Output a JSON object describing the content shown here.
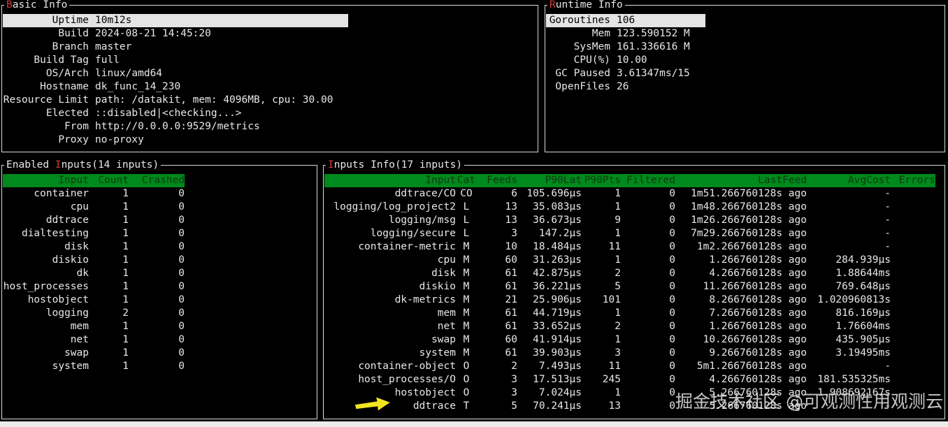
{
  "colors": {
    "background": "#000000",
    "text": "#e8e8e8",
    "border": "#d9d9d9",
    "accent_red": "#cc3b3b",
    "header_green": "#00891c",
    "header_green_text": "#0c3a10",
    "highlight_bg": "#e4e4e4",
    "highlight_text": "#000000",
    "arrow_yellow": "#f2e422"
  },
  "panels": {
    "basic_info": {
      "title": {
        "pre": "",
        "hot": "B",
        "rest": "asic Info"
      },
      "rows": [
        {
          "label": "Uptime",
          "value": "10m12s",
          "highlight": true
        },
        {
          "label": "Build",
          "value": "2024-08-21 14:45:20"
        },
        {
          "label": "Branch",
          "value": "master"
        },
        {
          "label": "Build Tag",
          "value": "full"
        },
        {
          "label": "OS/Arch",
          "value": "linux/amd64"
        },
        {
          "label": "Hostname",
          "value": "dk_func_14_230"
        },
        {
          "label": "Resource Limit",
          "value": "path: /datakit, mem: 4096MB, cpu: 30.00"
        },
        {
          "label": "Elected",
          "value": "::disabled|<checking...>"
        },
        {
          "label": "From",
          "value": "http://0.0.0.0:9529/metrics"
        },
        {
          "label": "Proxy",
          "value": "no-proxy"
        }
      ]
    },
    "runtime_info": {
      "title": {
        "pre": "",
        "hot": "R",
        "rest": "untime Info"
      },
      "rows": [
        {
          "label": "Goroutines",
          "value": "106",
          "highlight": true
        },
        {
          "label": "Mem",
          "value": "123.590152 M"
        },
        {
          "label": "SysMem",
          "value": "161.336616 M"
        },
        {
          "label": "CPU(%)",
          "value": "10.00"
        },
        {
          "label": "GC Paused",
          "value": "3.61347ms/15"
        },
        {
          "label": "OpenFiles",
          "value": "26"
        }
      ]
    },
    "enabled_inputs": {
      "title": {
        "pre": "Enabled ",
        "hot": "I",
        "rest": "nputs(14 inputs)"
      },
      "headers": [
        "Input",
        "Count",
        "Crashed"
      ],
      "rows": [
        [
          "container",
          "1",
          "0"
        ],
        [
          "cpu",
          "1",
          "0"
        ],
        [
          "ddtrace",
          "1",
          "0"
        ],
        [
          "dialtesting",
          "1",
          "0"
        ],
        [
          "disk",
          "1",
          "0"
        ],
        [
          "diskio",
          "1",
          "0"
        ],
        [
          "dk",
          "1",
          "0"
        ],
        [
          "host_processes",
          "1",
          "0"
        ],
        [
          "hostobject",
          "1",
          "0"
        ],
        [
          "logging",
          "2",
          "0"
        ],
        [
          "mem",
          "1",
          "0"
        ],
        [
          "net",
          "1",
          "0"
        ],
        [
          "swap",
          "1",
          "0"
        ],
        [
          "system",
          "1",
          "0"
        ]
      ]
    },
    "inputs_info": {
      "title": {
        "pre": "",
        "hot": "I",
        "rest": "nputs Info(17 inputs)"
      },
      "headers": [
        "Input",
        "Cat",
        "Feeds",
        "P90Lat",
        "P90Pts",
        "Filtered",
        "LastFeed",
        "AvgCost",
        "Errors"
      ],
      "rows": [
        [
          "ddtrace/CO",
          "CO",
          "6",
          "105.696µs",
          "1",
          "0",
          "1m51.266760128s ago",
          "-",
          ""
        ],
        [
          "logging/log_project2",
          "L",
          "13",
          "35.083µs",
          "1",
          "0",
          "1m48.266760128s ago",
          "-",
          ""
        ],
        [
          "logging/msg",
          "L",
          "13",
          "36.673µs",
          "9",
          "0",
          "1m26.266760128s ago",
          "-",
          ""
        ],
        [
          "logging/secure",
          "L",
          "3",
          "147.2µs",
          "1",
          "0",
          "7m29.266760128s ago",
          "-",
          ""
        ],
        [
          "container-metric",
          "M",
          "10",
          "18.484µs",
          "11",
          "0",
          "1m2.266760128s ago",
          "-",
          ""
        ],
        [
          "cpu",
          "M",
          "60",
          "31.263µs",
          "1",
          "0",
          "1.266760128s ago",
          "284.939µs",
          ""
        ],
        [
          "disk",
          "M",
          "61",
          "42.875µs",
          "2",
          "0",
          "4.266760128s ago",
          "1.88644ms",
          ""
        ],
        [
          "diskio",
          "M",
          "61",
          "36.221µs",
          "5",
          "0",
          "11.266760128s ago",
          "769.648µs",
          ""
        ],
        [
          "dk-metrics",
          "M",
          "21",
          "25.906µs",
          "101",
          "0",
          "8.266760128s ago",
          "1.020960813s",
          ""
        ],
        [
          "mem",
          "M",
          "61",
          "44.719µs",
          "1",
          "0",
          "7.266760128s ago",
          "816.169µs",
          ""
        ],
        [
          "net",
          "M",
          "61",
          "33.652µs",
          "2",
          "0",
          "1.266760128s ago",
          "1.76604ms",
          ""
        ],
        [
          "swap",
          "M",
          "60",
          "41.914µs",
          "1",
          "0",
          "10.266760128s ago",
          "435.905µs",
          ""
        ],
        [
          "system",
          "M",
          "61",
          "39.903µs",
          "3",
          "0",
          "9.266760128s ago",
          "3.19495ms",
          ""
        ],
        [
          "container-object",
          "O",
          "2",
          "7.493µs",
          "11",
          "0",
          "5m1.266760128s ago",
          "-",
          ""
        ],
        [
          "host_processes/O",
          "O",
          "3",
          "17.513µs",
          "245",
          "0",
          "4.266760128s ago",
          "181.535325ms",
          ""
        ],
        [
          "hostobject",
          "O",
          "3",
          "7.024µs",
          "1",
          "0",
          "5.266760128s ago",
          "1.908692167s",
          ""
        ],
        [
          "ddtrace",
          "T",
          "5",
          "70.241µs",
          "13",
          "0",
          "5.266760128s ago",
          "-",
          ""
        ]
      ]
    }
  },
  "watermark": "掘金技术社区 @可观测性用观测云"
}
